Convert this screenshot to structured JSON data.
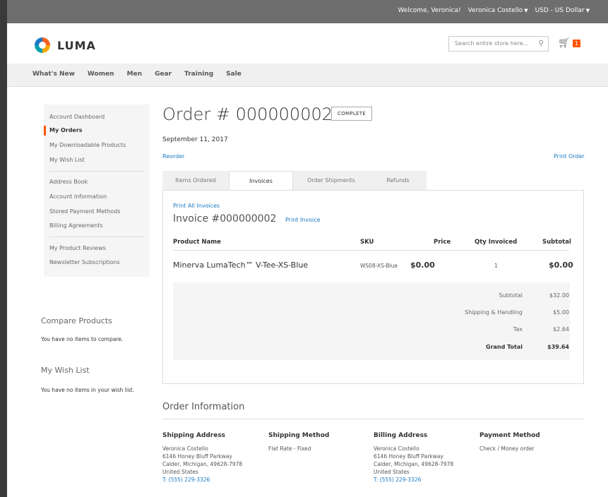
{
  "topbar": {
    "welcome": "Welcome, Veronica!",
    "account": "Veronica Costello",
    "currency": "USD - US Dollar"
  },
  "header": {
    "logo_text": "LUMA",
    "search_placeholder": "Search entire store here...",
    "cart_count": "1"
  },
  "nav": {
    "items": [
      "What's New",
      "Women",
      "Men",
      "Gear",
      "Training",
      "Sale"
    ]
  },
  "sidebar": {
    "items": [
      "Account Dashboard",
      "My Orders",
      "My Downloadable Products",
      "My Wish List",
      "Address Book",
      "Account Information",
      "Stored Payment Methods",
      "Billing Agreements",
      "My Product Reviews",
      "Newsletter Subscriptions"
    ]
  },
  "compare": {
    "title": "Compare Products",
    "text": "You have no items to compare."
  },
  "wishlist": {
    "title": "My Wish List",
    "text": "You have no items in your wish list."
  },
  "order": {
    "title": "Order # 000000002",
    "status": "COMPLETE",
    "date": "September 11, 2017",
    "reorder": "Reorder",
    "print_order": "Print Order"
  },
  "tabs": [
    "Items Ordered",
    "Invoices",
    "Order Shipments",
    "Refunds"
  ],
  "invoice": {
    "print_all": "Print All Invoices",
    "title": "Invoice #000000002",
    "print_invoice": "Print Invoice",
    "headers": [
      "Product Name",
      "SKU",
      "Price",
      "Qty Invoiced",
      "Subtotal"
    ],
    "row": {
      "name": "Minerva LumaTech™ V-Tee-XS-Blue",
      "sku": "WS08-XS-Blue",
      "price": "$0.00",
      "qty": "1",
      "subtotal": "$0.00"
    },
    "totals": [
      {
        "label": "Subtotal",
        "value": "$32.00"
      },
      {
        "label": "Shipping & Handling",
        "value": "$5.00"
      },
      {
        "label": "Tax",
        "value": "$2.64"
      },
      {
        "label": "Grand Total",
        "value": "$39.64"
      }
    ]
  },
  "order_info": {
    "title": "Order Information",
    "shipping_address": {
      "title": "Shipping Address",
      "lines": [
        "Veronica Costello",
        "6146 Honey Bluff Parkway",
        "Calder, Michigan, 49628-7978",
        "United States"
      ],
      "phone": "T: (555) 229-3326"
    },
    "shipping_method": {
      "title": "Shipping Method",
      "value": "Flat Rate - Fixed"
    },
    "billing_address": {
      "title": "Billing Address",
      "lines": [
        "Veronica Costello",
        "6146 Honey Bluff Parkway",
        "Calder, Michigan, 49628-7978",
        "United States"
      ],
      "phone": "T: (555) 229-3326"
    },
    "payment_method": {
      "title": "Payment Method",
      "value": "Check / Money order"
    }
  },
  "colors": {
    "accent": "#ff5501",
    "link": "#1979c3"
  }
}
